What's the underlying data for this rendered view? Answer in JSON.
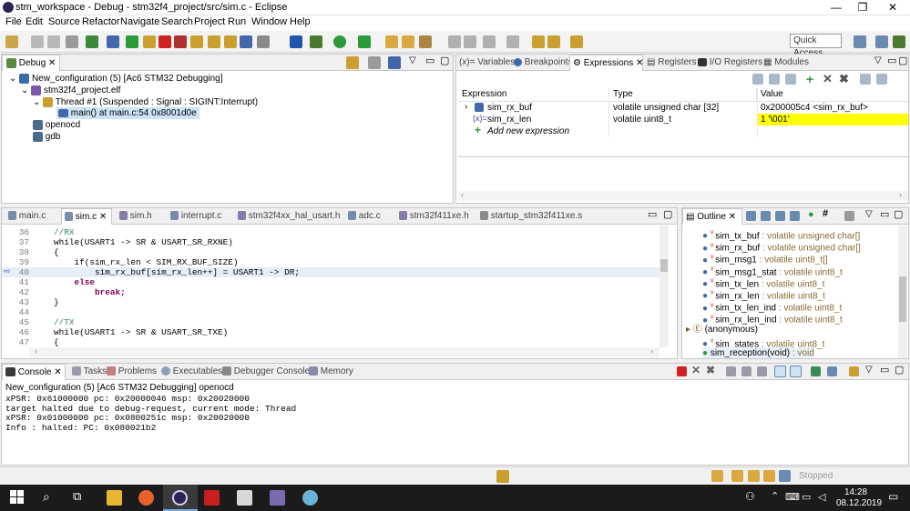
{
  "window": {
    "title": "stm_workspace - Debug - stm32f4_project/src/sim.c - Eclipse",
    "min": "—",
    "max": "❐",
    "close": "✕"
  },
  "menu": [
    "File",
    "Edit",
    "Source",
    "Refactor",
    "Navigate",
    "Search",
    "Project",
    "Run",
    "Window",
    "Help"
  ],
  "quick_access": "Quick Access",
  "debug": {
    "tab": "Debug",
    "items": [
      "New_configuration (5) [Ac6 STM32 Debugging]",
      "stm32f4_project.elf",
      "Thread #1 (Suspended : Signal : SIGINT:Interrupt)",
      "main() at main.c:54 0x8001d0e",
      "openocd",
      "gdb"
    ]
  },
  "right_tabs": [
    "(x)= Variables",
    "Breakpoints",
    "Expressions",
    "Registers",
    "I/O Registers",
    "Modules"
  ],
  "expressions": {
    "headers": [
      "Expression",
      "Type",
      "Value"
    ],
    "rows": [
      {
        "name": "sim_rx_buf",
        "type": "volatile unsigned char [32]",
        "value": "0x200005c4 <sim_rx_buf>"
      },
      {
        "name": "sim_rx_len",
        "type": "volatile uint8_t",
        "value": "1 '\\001'"
      }
    ],
    "add": "Add new expression"
  },
  "editor_tabs": [
    "main.c",
    "sim.c",
    "sim.h",
    "interrupt.c",
    "stm32f4xx_hal_usart.h",
    "adc.c",
    "stm32f411xe.h",
    "startup_stm32f411xe.s"
  ],
  "code": [
    {
      "n": "36",
      "t": "//RX"
    },
    {
      "n": "37",
      "t": "while(USART1 -> SR & USART_SR_RXNE)"
    },
    {
      "n": "38",
      "t": "{"
    },
    {
      "n": "39",
      "t": "    if(sim_rx_len < SIM_RX_BUF_SIZE)"
    },
    {
      "n": "40",
      "t": "        sim_rx_buf[sim_rx_len++] = USART1 -> DR;"
    },
    {
      "n": "41",
      "t": "    else"
    },
    {
      "n": "42",
      "t": "        break;"
    },
    {
      "n": "43",
      "t": "}"
    },
    {
      "n": "44",
      "t": ""
    },
    {
      "n": "45",
      "t": "//TX"
    },
    {
      "n": "46",
      "t": "while(USART1 -> SR & USART_SR_TXE)"
    },
    {
      "n": "47",
      "t": "{"
    }
  ],
  "outline": {
    "tab": "Outline",
    "items": [
      {
        "name": "sim_tx_buf",
        "type": " : volatile unsigned char[]"
      },
      {
        "name": "sim_rx_buf",
        "type": " : volatile unsigned char[]"
      },
      {
        "name": "sim_msg1",
        "type": " : volatile uint8_t[]"
      },
      {
        "name": "sim_msg1_stat",
        "type": " : volatile uint8_t"
      },
      {
        "name": "sim_tx_len",
        "type": " : volatile uint8_t"
      },
      {
        "name": "sim_rx_len",
        "type": " : volatile uint8_t"
      },
      {
        "name": "sim_tx_len_ind",
        "type": " : volatile uint8_t"
      },
      {
        "name": "sim_rx_len_ind",
        "type": " : volatile uint8_t"
      },
      {
        "name": "(anonymous)",
        "type": ""
      },
      {
        "name": "sim_states",
        "type": " : volatile uint8_t"
      },
      {
        "name": "sim_reception(void)",
        "type": " : void"
      }
    ]
  },
  "console_tabs": [
    "Console",
    "Tasks",
    "Problems",
    "Executables",
    "Debugger Console",
    "Memory"
  ],
  "console": {
    "title": "New_configuration (5) [Ac6 STM32 Debugging] openocd",
    "lines": [
      "xPSR: 0x61000000 pc: 0x20000046 msp: 0x20020000",
      "target halted due to debug-request, current mode: Thread",
      "xPSR: 0x01000000 pc: 0x0800251c msp: 0x20020000",
      "Info : halted: PC: 0x080021b2"
    ]
  },
  "status": {
    "state": "Stopped"
  },
  "clock": {
    "time": "14:28",
    "date": "08.12.2019"
  }
}
